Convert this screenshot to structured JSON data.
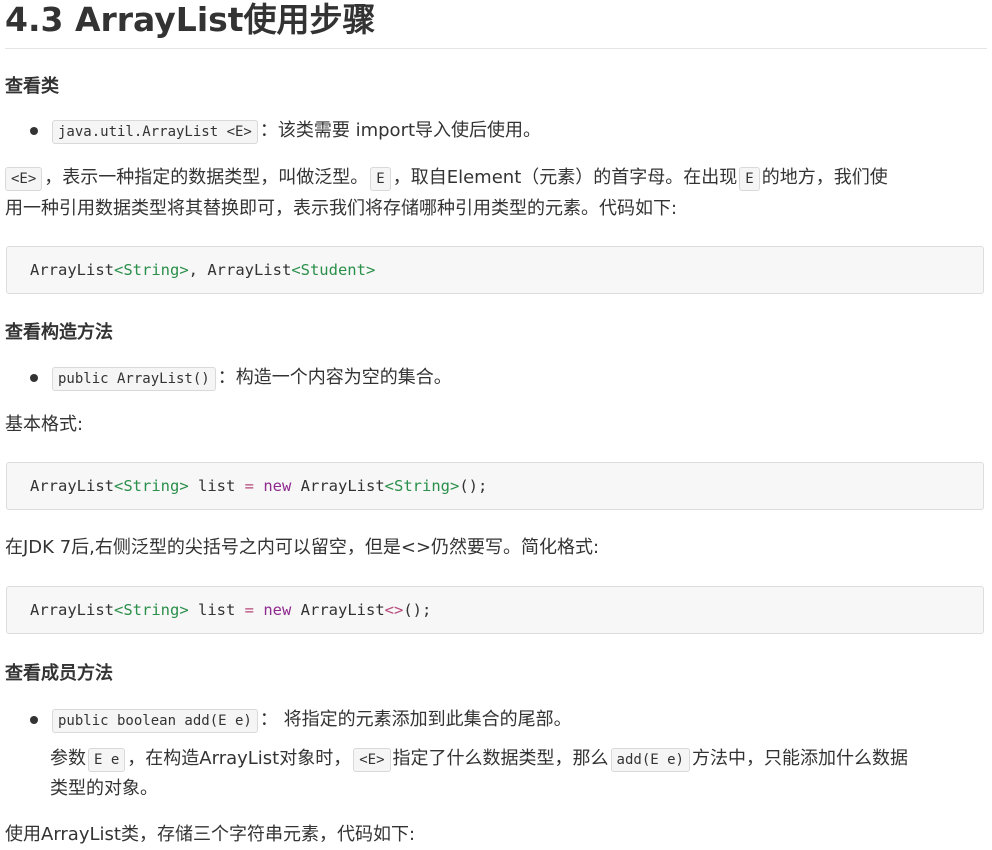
{
  "title": "4.3 ArrayList使用步骤",
  "section1": {
    "heading": "查看类",
    "bullet_code": "java.util.ArrayList <E>",
    "bullet_text": "：该类需要 import导入使后使用。",
    "para_code1": "<E>",
    "para_t1": "，表示一种指定的数据类型，叫做泛型。",
    "para_code2": "E",
    "para_t2": "，取自Element（元素）的首字母。在出现",
    "para_code3": "E",
    "para_t3": "的地方，我们使",
    "para_line2": "用一种引用数据类型将其替换即可，表示我们将存储哪种引用类型的元素。代码如下:",
    "code": {
      "p1": "ArrayList",
      "g1": "<String>",
      "p2": ", ArrayList",
      "g2": "<Student>"
    }
  },
  "section2": {
    "heading": "查看构造方法",
    "bullet_code": "public ArrayList()",
    "bullet_text": "：构造一个内容为空的集合。",
    "format_label": "基本格式:",
    "code1": {
      "p1": "ArrayList",
      "g1": "<String>",
      "p2": " list ",
      "eq": "=",
      "sp": " ",
      "kw": "new",
      "p3": " ArrayList",
      "g2": "<String>",
      "p4": "();"
    },
    "note": "在JDK 7后,右侧泛型的尖括号之内可以留空，但是<>仍然要写。简化格式:",
    "code2": {
      "p1": "ArrayList",
      "g1": "<String>",
      "p2": " list ",
      "eq": "=",
      "sp": " ",
      "kw": "new",
      "p3": " ArrayList",
      "g2": "<>",
      "p4": "();"
    }
  },
  "section3": {
    "heading": "查看成员方法",
    "bullet_code": "public boolean add(E e)",
    "bullet_text": "： 将指定的元素添加到此集合的尾部。",
    "sub_t1": "参数",
    "sub_code1": "E e",
    "sub_t2": "，在构造ArrayList对象时，",
    "sub_code2": "<E>",
    "sub_t3": "指定了什么数据类型，那么",
    "sub_code3": "add(E e)",
    "sub_t4": "方法中，只能添加什么数据",
    "sub_line2": "类型的对象。",
    "final_text": "使用ArrayList类，存储三个字符串元素，代码如下:"
  }
}
